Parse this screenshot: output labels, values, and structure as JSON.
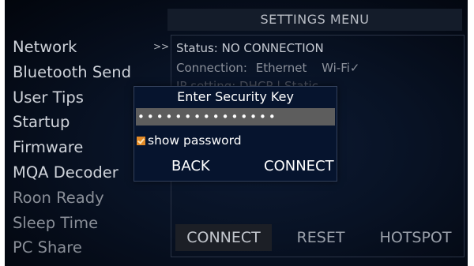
{
  "header": {
    "title": "SETTINGS MENU"
  },
  "sidebar": {
    "items": [
      {
        "label": "Network"
      },
      {
        "label": "Bluetooth Send"
      },
      {
        "label": "User Tips"
      },
      {
        "label": "Startup"
      },
      {
        "label": "Firmware"
      },
      {
        "label": "MQA Decoder"
      },
      {
        "label": "Roon Ready"
      },
      {
        "label": "Sleep Time"
      },
      {
        "label": "PC Share"
      }
    ],
    "arrow": ">>"
  },
  "network_panel": {
    "status": "Status: NO CONNECTION",
    "connection_label": "Connection:",
    "connection_ethernet": "Ethernet",
    "connection_wifi": "Wi-Fi",
    "connection_check": "✓",
    "ip_setting": "IP setting:   DHCP  |  Static"
  },
  "bottom_buttons": {
    "connect": "CONNECT",
    "reset": "RESET",
    "hotspot": "HOTSPOT"
  },
  "dialog": {
    "title": "Enter Security Key",
    "password_value": "•••••••••••••••",
    "show_password_label": "show password",
    "back_label": "BACK",
    "connect_label": "CONNECT"
  },
  "colors": {
    "checkbox": "#e28a28",
    "password_field": "#5d5d5d",
    "background": "#081224"
  }
}
